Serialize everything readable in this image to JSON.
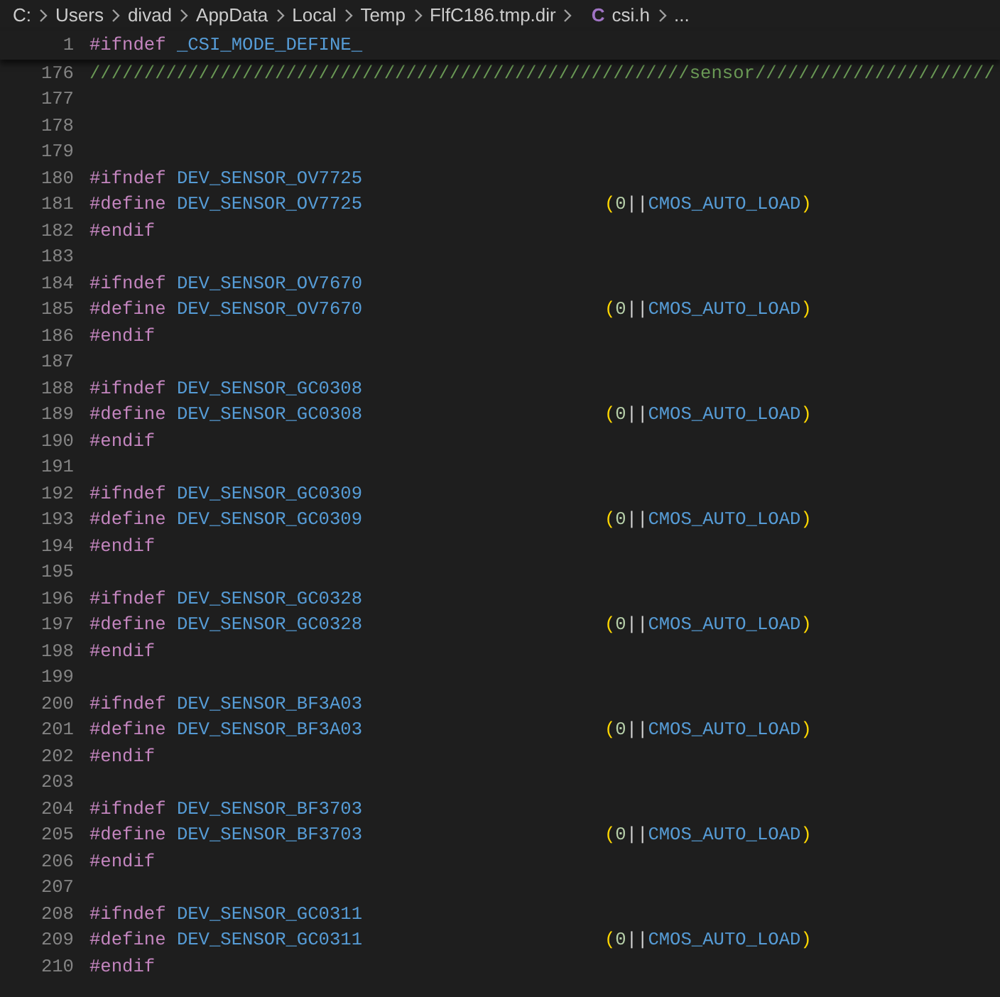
{
  "breadcrumb": {
    "segments": [
      "C:",
      "Users",
      "divad",
      "AppData",
      "Local",
      "Temp",
      "FlfC186.tmp.dir"
    ],
    "file": {
      "icon": "C",
      "name": "csi.h"
    },
    "more": "..."
  },
  "sticky_line": {
    "number": "1",
    "kind": "ifndef",
    "directive": "#ifndef",
    "name": "_CSI_MODE_DEFINE_"
  },
  "partial_line": {
    "number": "176",
    "kind": "comment",
    "text": "///////////////////////////////////////////////////////sensor//////////////////////"
  },
  "lines": [
    {
      "number": "177",
      "kind": "blank"
    },
    {
      "number": "178",
      "kind": "blank"
    },
    {
      "number": "179",
      "kind": "blank"
    },
    {
      "number": "180",
      "kind": "ifndef",
      "directive": "#ifndef",
      "name": "DEV_SENSOR_OV7725"
    },
    {
      "number": "181",
      "kind": "define",
      "directive": "#define",
      "name": "DEV_SENSOR_OV7725",
      "value": [
        "(",
        "0",
        "||",
        "CMOS_AUTO_LOAD",
        ")"
      ]
    },
    {
      "number": "182",
      "kind": "endif",
      "directive": "#endif"
    },
    {
      "number": "183",
      "kind": "blank"
    },
    {
      "number": "184",
      "kind": "ifndef",
      "directive": "#ifndef",
      "name": "DEV_SENSOR_OV7670"
    },
    {
      "number": "185",
      "kind": "define",
      "directive": "#define",
      "name": "DEV_SENSOR_OV7670",
      "value": [
        "(",
        "0",
        "||",
        "CMOS_AUTO_LOAD",
        ")"
      ]
    },
    {
      "number": "186",
      "kind": "endif",
      "directive": "#endif"
    },
    {
      "number": "187",
      "kind": "blank"
    },
    {
      "number": "188",
      "kind": "ifndef",
      "directive": "#ifndef",
      "name": "DEV_SENSOR_GC0308"
    },
    {
      "number": "189",
      "kind": "define",
      "directive": "#define",
      "name": "DEV_SENSOR_GC0308",
      "value": [
        "(",
        "0",
        "||",
        "CMOS_AUTO_LOAD",
        ")"
      ]
    },
    {
      "number": "190",
      "kind": "endif",
      "directive": "#endif"
    },
    {
      "number": "191",
      "kind": "blank"
    },
    {
      "number": "192",
      "kind": "ifndef",
      "directive": "#ifndef",
      "name": "DEV_SENSOR_GC0309"
    },
    {
      "number": "193",
      "kind": "define",
      "directive": "#define",
      "name": "DEV_SENSOR_GC0309",
      "value": [
        "(",
        "0",
        "||",
        "CMOS_AUTO_LOAD",
        ")"
      ]
    },
    {
      "number": "194",
      "kind": "endif",
      "directive": "#endif"
    },
    {
      "number": "195",
      "kind": "blank"
    },
    {
      "number": "196",
      "kind": "ifndef",
      "directive": "#ifndef",
      "name": "DEV_SENSOR_GC0328"
    },
    {
      "number": "197",
      "kind": "define",
      "directive": "#define",
      "name": "DEV_SENSOR_GC0328",
      "value": [
        "(",
        "0",
        "||",
        "CMOS_AUTO_LOAD",
        ")"
      ]
    },
    {
      "number": "198",
      "kind": "endif",
      "directive": "#endif"
    },
    {
      "number": "199",
      "kind": "blank"
    },
    {
      "number": "200",
      "kind": "ifndef",
      "directive": "#ifndef",
      "name": "DEV_SENSOR_BF3A03"
    },
    {
      "number": "201",
      "kind": "define",
      "directive": "#define",
      "name": "DEV_SENSOR_BF3A03",
      "value": [
        "(",
        "0",
        "||",
        "CMOS_AUTO_LOAD",
        ")"
      ]
    },
    {
      "number": "202",
      "kind": "endif",
      "directive": "#endif"
    },
    {
      "number": "203",
      "kind": "blank"
    },
    {
      "number": "204",
      "kind": "ifndef",
      "directive": "#ifndef",
      "name": "DEV_SENSOR_BF3703"
    },
    {
      "number": "205",
      "kind": "define",
      "directive": "#define",
      "name": "DEV_SENSOR_BF3703",
      "value": [
        "(",
        "0",
        "||",
        "CMOS_AUTO_LOAD",
        ")"
      ]
    },
    {
      "number": "206",
      "kind": "endif",
      "directive": "#endif"
    },
    {
      "number": "207",
      "kind": "blank"
    },
    {
      "number": "208",
      "kind": "ifndef",
      "directive": "#ifndef",
      "name": "DEV_SENSOR_GC0311"
    },
    {
      "number": "209",
      "kind": "define",
      "directive": "#define",
      "name": "DEV_SENSOR_GC0311",
      "value": [
        "(",
        "0",
        "||",
        "CMOS_AUTO_LOAD",
        ")"
      ]
    },
    {
      "number": "210",
      "kind": "endif",
      "directive": "#endif"
    }
  ]
}
